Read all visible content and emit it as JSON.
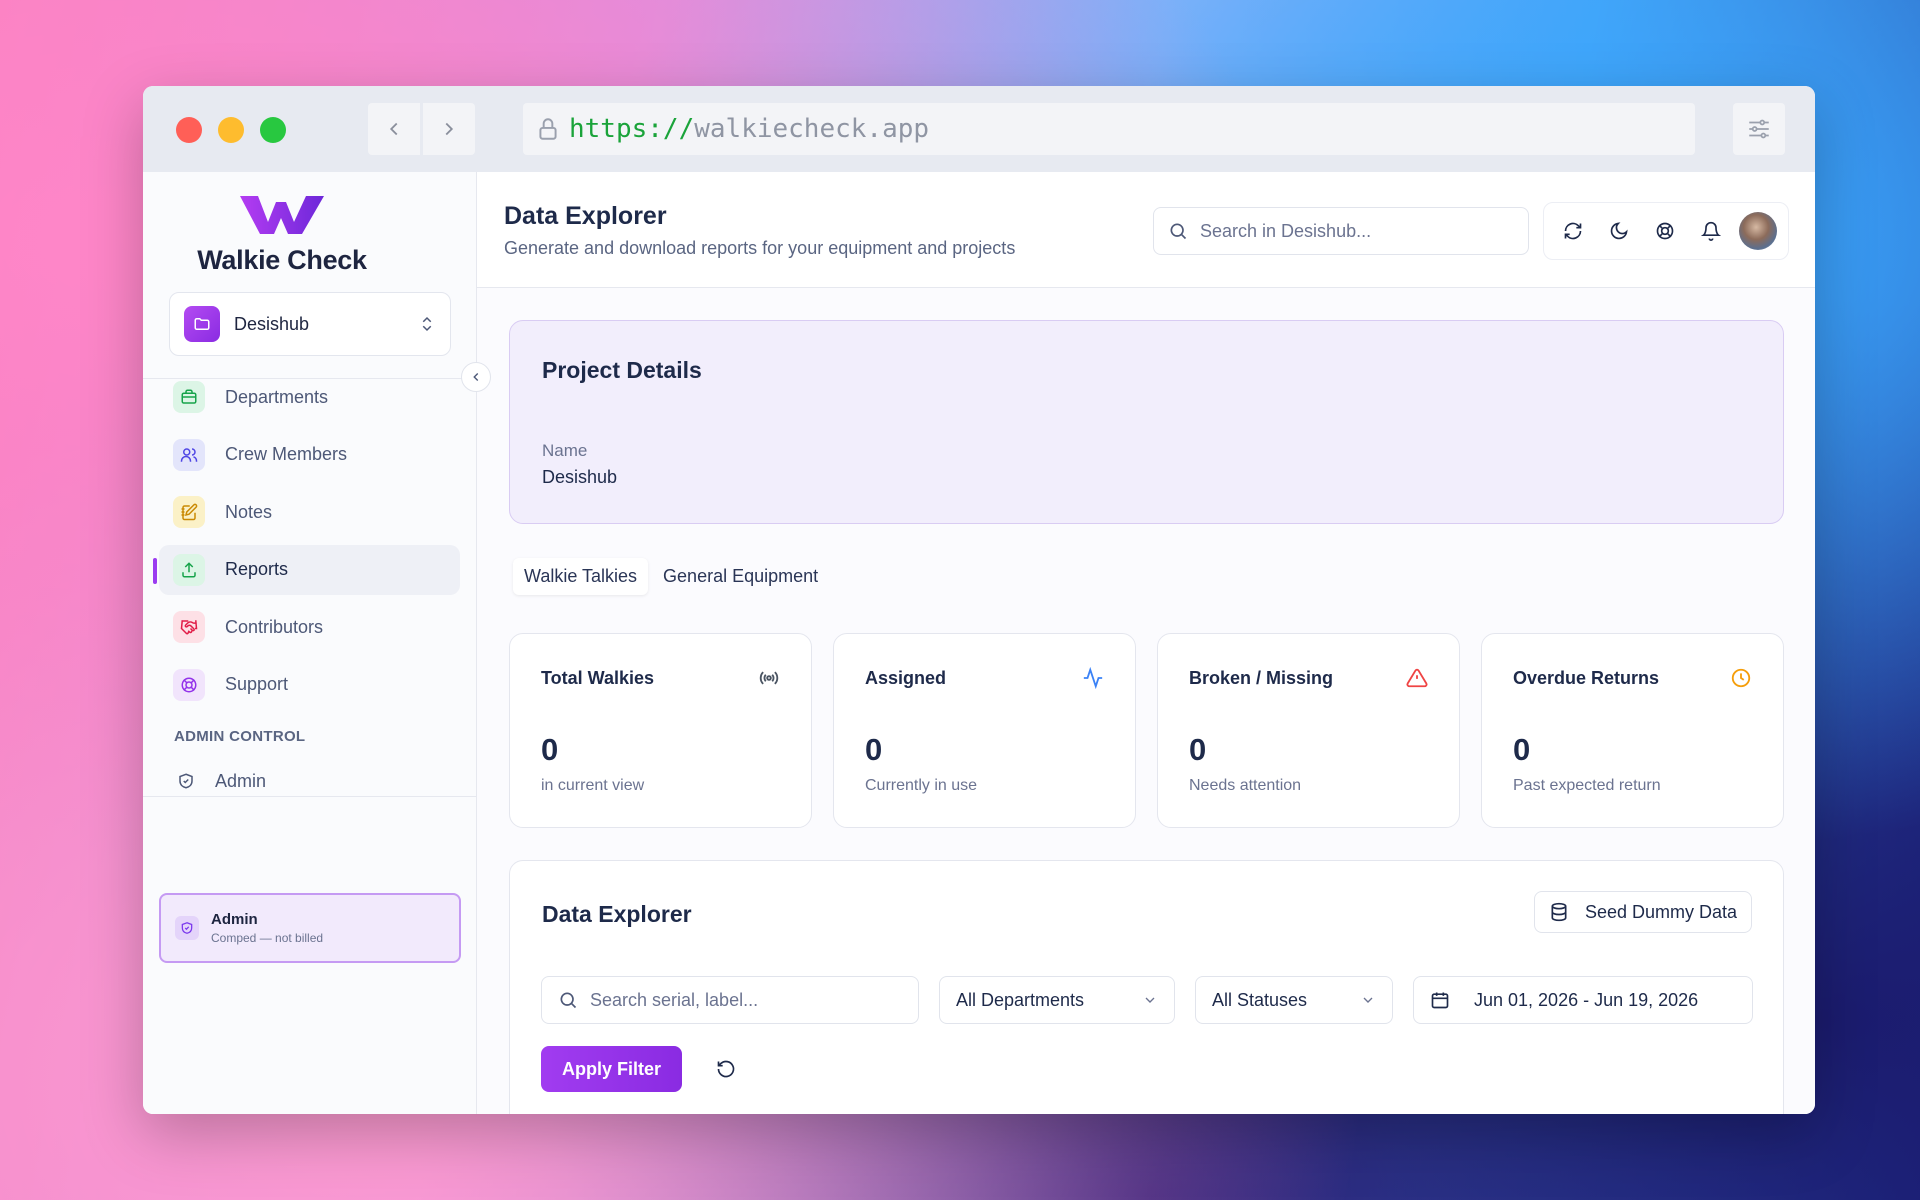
{
  "browser": {
    "url_protocol": "https://",
    "url_host": "walkiecheck.app"
  },
  "brand": {
    "name": "Walkie Check"
  },
  "project_selector": {
    "name": "Desishub"
  },
  "sidebar": {
    "items": [
      {
        "label": "Departments",
        "icon": "briefcase-icon",
        "color": "#16a34a"
      },
      {
        "label": "Crew Members",
        "icon": "users-icon",
        "color": "#4f46e5"
      },
      {
        "label": "Notes",
        "icon": "notebook-pen-icon",
        "color": "#ca8a04"
      },
      {
        "label": "Reports",
        "icon": "upload-icon",
        "color": "#16a34a",
        "active": true
      },
      {
        "label": "Contributors",
        "icon": "handshake-icon",
        "color": "#e11d48"
      },
      {
        "label": "Support",
        "icon": "lifebuoy-icon",
        "color": "#9333ea"
      }
    ],
    "section_title": "ADMIN CONTROL",
    "admin_item": "Admin",
    "account": {
      "title": "Admin",
      "subtitle": "Comped — not billed"
    }
  },
  "header": {
    "title": "Data Explorer",
    "subtitle": "Generate and download reports for your equipment and projects",
    "search_placeholder": "Search in Desishub..."
  },
  "project_details": {
    "title": "Project Details",
    "name_label": "Name",
    "name_value": "Desishub"
  },
  "tabs": [
    {
      "label": "Walkie Talkies",
      "active": true
    },
    {
      "label": "General Equipment",
      "active": false
    }
  ],
  "stats": [
    {
      "title": "Total Walkies",
      "value": "0",
      "sub": "in current view",
      "icon": "radio-icon",
      "color": "#4b5563"
    },
    {
      "title": "Assigned",
      "value": "0",
      "sub": "Currently in use",
      "icon": "activity-icon",
      "color": "#3b82f6"
    },
    {
      "title": "Broken / Missing",
      "value": "0",
      "sub": "Needs attention",
      "icon": "alert-triangle-icon",
      "color": "#ef4444"
    },
    {
      "title": "Overdue Returns",
      "value": "0",
      "sub": "Past expected return",
      "icon": "clock-icon",
      "color": "#f59e0b"
    }
  ],
  "explorer": {
    "title": "Data Explorer",
    "seed_button": "Seed Dummy Data",
    "search_placeholder": "Search serial, label...",
    "department_filter": "All Departments",
    "status_filter": "All Statuses",
    "date_range": "Jun 01, 2026 - Jun 19, 2026",
    "apply_button": "Apply Filter"
  },
  "colors": {
    "accent": "#9333ea",
    "text": "#1e2a4a"
  }
}
